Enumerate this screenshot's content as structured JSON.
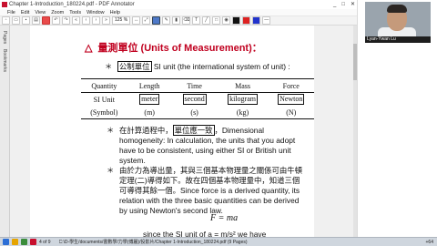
{
  "window": {
    "title": "Chapter 1-Introduction_180224.pdf - PDF Annotator",
    "controls": [
      "_",
      "□",
      "✕"
    ]
  },
  "menu": [
    "File",
    "Edit",
    "View",
    "Zoom",
    "Tools",
    "Window",
    "Help"
  ],
  "toolbar": {
    "zoom": "125 %"
  },
  "sidebar": {
    "tabs": [
      "Pages",
      "Bookmarks"
    ]
  },
  "slide": {
    "title_symbol": "△",
    "title": "量測單位 (Units of Measurement)：",
    "si": {
      "star": "＊",
      "term": "公制單位",
      "text": " SI unit (the international system of unit) :"
    },
    "table": {
      "headers": [
        "Quantity",
        "Length",
        "Time",
        "Mass",
        "Force"
      ],
      "unit_row": [
        "SI Unit",
        "meter",
        "second",
        "kilogram",
        "Newton"
      ],
      "symbol_row": [
        "(Symbol)",
        "(m)",
        "(s)",
        "(kg)",
        "(N)"
      ]
    },
    "homog": {
      "star": "＊",
      "pre": "在計算過程中，",
      "term": "單位應一致",
      "rest": "，Dimensional homogeneity: In calculation, the units that you adopt have to be consistent, using either SI or British unit system."
    },
    "force": {
      "star": "＊",
      "text": "由於力為導出量，其與三個基本物理量之關係可由牛頓定理(二)導得如下。故在四個基本物理量中，知道三個可導得其餘一個。Since force is a derived quantity, its relation with the three basic quantities can be derived by using Newton's second law."
    },
    "formula": "F = ma",
    "footer": "since the SI unit of   a = m/s²   we have"
  },
  "taskbar": {
    "path": "C:\\D-學生/documents/書數學/力學(傅麗)/投影片/Chapter 1-Introduction_180224.pdf (9 Pages)",
    "page_indicator": "4 of 9",
    "right": "+64"
  },
  "video": {
    "participant": "Lyan-Ywan Lu"
  }
}
